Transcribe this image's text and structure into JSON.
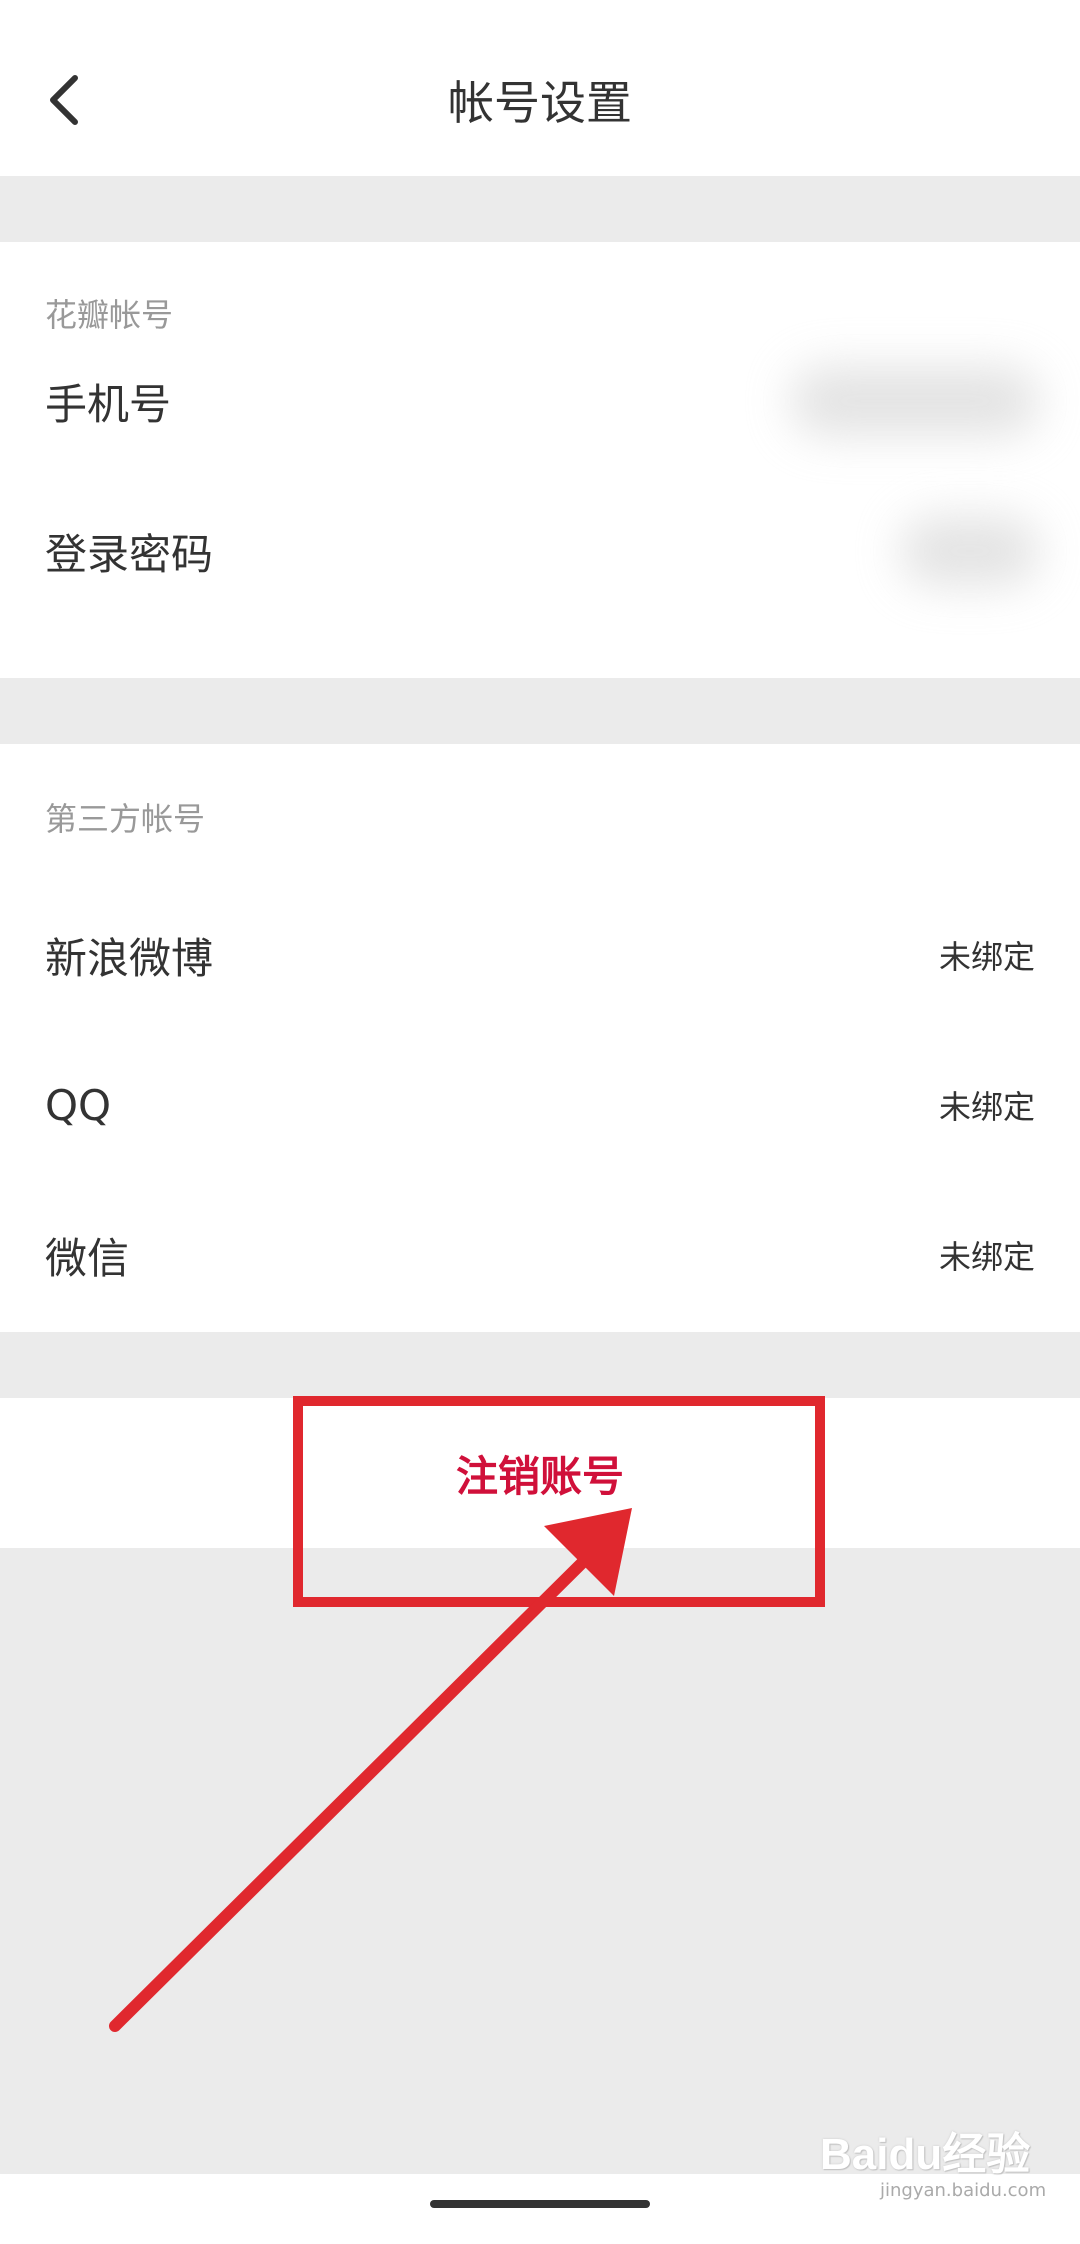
{
  "header": {
    "title": "帐号设置",
    "back_icon": "chevron-left-icon"
  },
  "huaban_section": {
    "label": "花瓣帐号",
    "items": [
      {
        "label": "手机号"
      },
      {
        "label": "登录密码"
      }
    ]
  },
  "third_party_section": {
    "label": "第三方帐号",
    "items": [
      {
        "label": "新浪微博",
        "value": "未绑定"
      },
      {
        "label": "QQ",
        "value": "未绑定"
      },
      {
        "label": "微信",
        "value": "未绑定"
      }
    ]
  },
  "logout": {
    "label": "注销账号"
  },
  "watermark": {
    "text": "Baidu经验",
    "sub": "jingyan.baidu.com"
  },
  "colors": {
    "accent": "#d0103a",
    "annotation": "#e0282e",
    "background": "#ebebeb"
  }
}
